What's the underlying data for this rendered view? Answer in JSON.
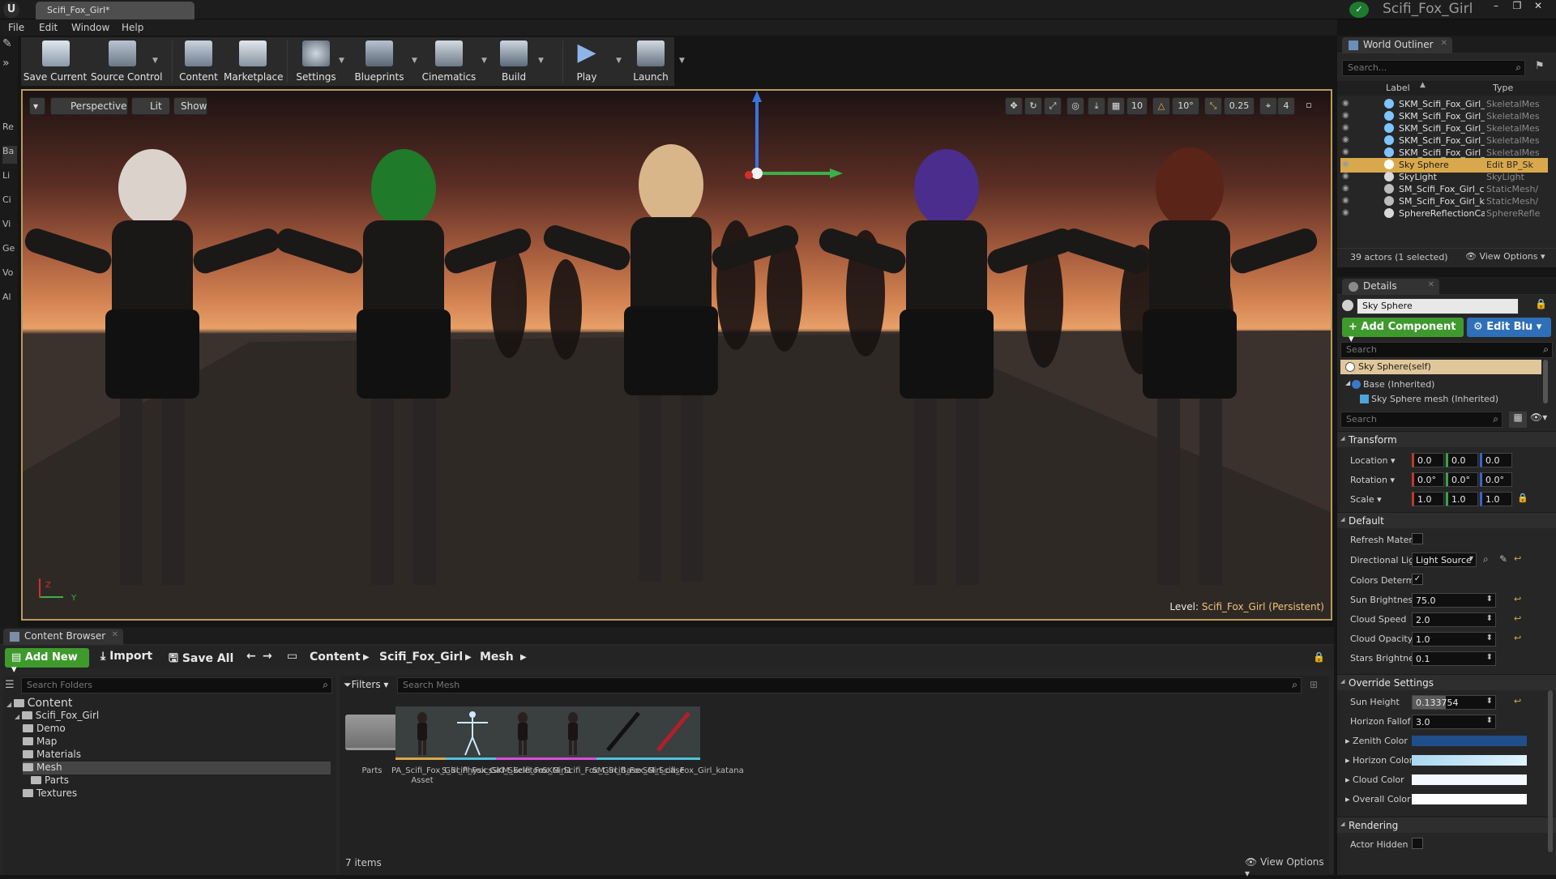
{
  "titlebar": {
    "doc_tab": "Scifi_Fox_Girl*",
    "project": "Scifi_Fox_Girl"
  },
  "menu": [
    "File",
    "Edit",
    "Window",
    "Help"
  ],
  "left_tabs": [
    "Re",
    "Ba",
    "Li",
    "Ci",
    "Vi",
    "Ge",
    "Vo",
    "Al"
  ],
  "toolbar": [
    {
      "label": "Save Current",
      "icon": "save-icon"
    },
    {
      "label": "Source Control",
      "icon": "source-control-icon"
    },
    {
      "label": "Content",
      "icon": "content-icon"
    },
    {
      "label": "Marketplace",
      "icon": "marketplace-icon"
    },
    {
      "label": "Settings",
      "icon": "settings-icon"
    },
    {
      "label": "Blueprints",
      "icon": "blueprints-icon"
    },
    {
      "label": "Cinematics",
      "icon": "cinematics-icon"
    },
    {
      "label": "Build",
      "icon": "build-icon"
    },
    {
      "label": "Play",
      "icon": "play-icon"
    },
    {
      "label": "Launch",
      "icon": "launch-icon"
    }
  ],
  "viewport": {
    "perspective": "Perspective",
    "lit": "Lit",
    "show": "Show",
    "grid_snap": "10",
    "rot_snap": "10°",
    "scale_snap": "0.25",
    "cam_speed": "4",
    "level_label": "Level:",
    "level_name": "Scifi_Fox_Girl (Persistent)",
    "axis_z": "Z",
    "axis_y": "Y"
  },
  "outliner": {
    "tab": "World Outliner",
    "search_placeholder": "Search...",
    "col_label": "Label",
    "col_type": "Type",
    "rows": [
      {
        "label": "SKM_Scifi_Fox_Girl_",
        "type": "SkeletalMes"
      },
      {
        "label": "SKM_Scifi_Fox_Girl_",
        "type": "SkeletalMes"
      },
      {
        "label": "SKM_Scifi_Fox_Girl_",
        "type": "SkeletalMes"
      },
      {
        "label": "SKM_Scifi_Fox_Girl_",
        "type": "SkeletalMes"
      },
      {
        "label": "SKM_Scifi_Fox_Girl_",
        "type": "SkeletalMes"
      },
      {
        "label": "Sky Sphere",
        "type": "Edit BP_Sk"
      },
      {
        "label": "SkyLight",
        "type": "SkyLight"
      },
      {
        "label": "SM_Scifi_Fox_Girl_c",
        "type": "StaticMesh/"
      },
      {
        "label": "SM_Scifi_Fox_Girl_k",
        "type": "StaticMesh/"
      },
      {
        "label": "SphereReflectionCa",
        "type": "SphereRefle"
      }
    ],
    "count": "39 actors (1 selected)",
    "view_options": "View Options"
  },
  "details": {
    "tab": "Details",
    "name_value": "Sky Sphere",
    "add_component": "Add Component",
    "edit_blueprint": "Edit Blu",
    "search_placeholder": "Search",
    "component_self": "Sky Sphere(self)",
    "component_base": "Base (Inherited)",
    "component_mesh": "Sky Sphere mesh (Inherited)",
    "search2_placeholder": "Search",
    "transform": {
      "title": "Transform",
      "location_label": "Location",
      "rotation_label": "Rotation",
      "scale_label": "Scale",
      "location": [
        "0.0",
        "0.0",
        "0.0"
      ],
      "rotation": [
        "0.0°",
        "0.0°",
        "0.0°"
      ],
      "scale": [
        "1.0",
        "1.0",
        "1.0"
      ]
    },
    "default": {
      "title": "Default",
      "refresh_material": "Refresh Mater",
      "directional_light": "Directional Lig",
      "light_source": "Light Source",
      "colors_determined": "Colors Determ",
      "sun_brightness_label": "Sun Brightnes",
      "sun_brightness": "75.0",
      "cloud_speed_label": "Cloud Speed",
      "cloud_speed": "2.0",
      "cloud_opacity_label": "Cloud Opacity",
      "cloud_opacity": "1.0",
      "stars_brightness_label": "Stars Brightne",
      "stars_brightness": "0.1"
    },
    "override": {
      "title": "Override Settings",
      "sun_height_label": "Sun Height",
      "sun_height": "0.133754",
      "horizon_falloff_label": "Horizon Fallof",
      "horizon_falloff": "3.0",
      "zenith_color": "Zenith Color",
      "horizon_color": "Horizon Color",
      "cloud_color": "Cloud Color",
      "overall_color": "Overall Color"
    },
    "rendering": {
      "title": "Rendering",
      "actor_hidden": "Actor Hidden I"
    }
  },
  "content_browser": {
    "tab": "Content Browser",
    "add_new": "Add New",
    "import": "Import",
    "save_all": "Save All",
    "crumbs": [
      "Content",
      "Scifi_Fox_Girl",
      "Mesh"
    ],
    "search_folders": "Search Folders",
    "filters": "Filters",
    "search_mesh": "Search Mesh",
    "tree": [
      {
        "label": "Content",
        "level": 0
      },
      {
        "label": "Scifi_Fox_Girl",
        "level": 1
      },
      {
        "label": "Demo",
        "level": 2
      },
      {
        "label": "Map",
        "level": 2
      },
      {
        "label": "Materials",
        "level": 2
      },
      {
        "label": "Mesh",
        "level": 2
      },
      {
        "label": "Parts",
        "level": 3
      },
      {
        "label": "Textures",
        "level": 2
      }
    ],
    "assets": [
      {
        "label": "Parts",
        "color": "#9a9a9a"
      },
      {
        "label": "PA_Scifi_Fox_Girl_Physics Asset",
        "color": "#d9a84c"
      },
      {
        "label": "S_Scifi_Fox_Girl_Skeleton",
        "color": "#4fc3d9"
      },
      {
        "label": "SKM_Scifi_Fox_Girl1",
        "color": "#d64fd9"
      },
      {
        "label": "SKM_Scifi_Fox_Girl_Base",
        "color": "#d64fd9"
      },
      {
        "label": "SM_Scifi_Fox_Girl_case",
        "color": "#4fc3d9"
      },
      {
        "label": "SM_Scifi_Fox_Girl_katana",
        "color": "#4fc3d9"
      }
    ],
    "items_count": "7 items",
    "view_options": "View Options"
  }
}
